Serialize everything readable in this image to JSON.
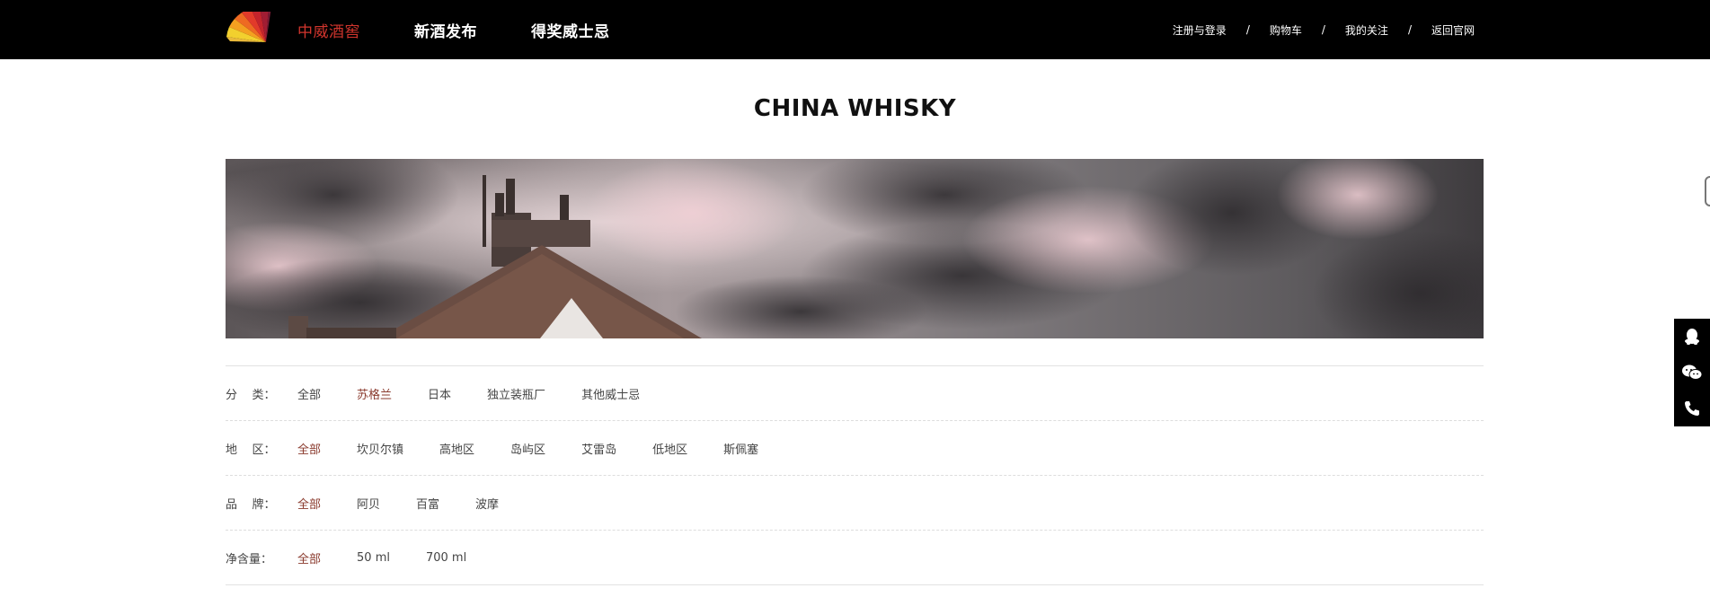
{
  "nav": {
    "brand_label": "中威酒窖",
    "items": [
      {
        "label": "新酒发布"
      },
      {
        "label": "得奖威士忌"
      }
    ],
    "right_links": [
      {
        "label": "注册与登录"
      },
      {
        "label": "购物车"
      },
      {
        "label": "我的关注"
      },
      {
        "label": "返回官网"
      }
    ],
    "separator": "/"
  },
  "page": {
    "title": "CHINA WHISKY"
  },
  "filters": [
    {
      "label": "分    类：",
      "options": [
        "全部",
        "苏格兰",
        "日本",
        "独立装瓶厂",
        "其他威士忌"
      ],
      "selected": 1
    },
    {
      "label": "地    区：",
      "options": [
        "全部",
        "坎贝尔镇",
        "高地区",
        "岛屿区",
        "艾雷岛",
        "低地区",
        "斯佩塞"
      ],
      "selected": 0
    },
    {
      "label": "品    牌：",
      "options": [
        "全部",
        "阿贝",
        "百富",
        "波摩"
      ],
      "selected": 0
    },
    {
      "label": "净含量：",
      "options": [
        "全部",
        "50 ml",
        "700 ml"
      ],
      "selected": 0
    }
  ],
  "sidebar": {
    "icons": [
      "qq-icon",
      "wechat-icon",
      "phone-icon"
    ]
  },
  "colors": {
    "accent_red": "#d2352d",
    "selected_option": "#8a3a2d",
    "topbar_bg": "#000000"
  }
}
